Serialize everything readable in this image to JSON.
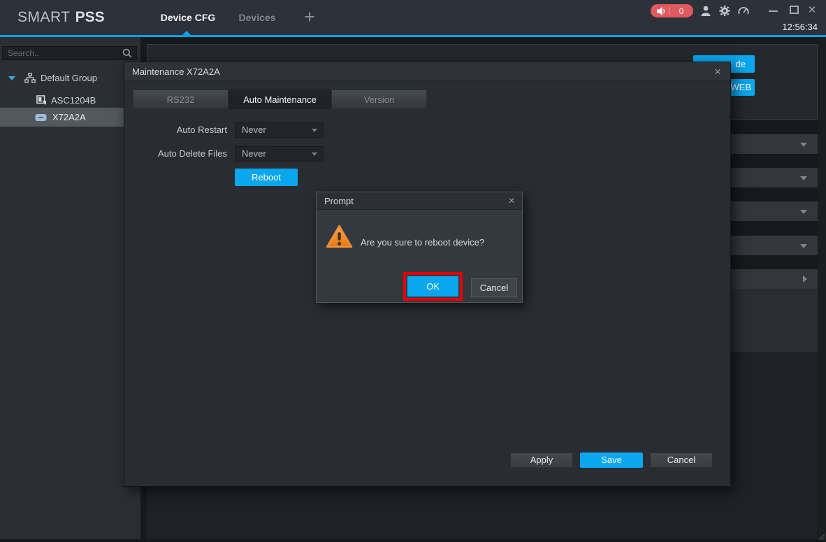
{
  "topbar": {
    "logo_part1": "SMART",
    "logo_part2": "PSS",
    "tabs": [
      {
        "label": "Device CFG",
        "active": true
      },
      {
        "label": "Devices",
        "active": false
      }
    ],
    "add_tab_label": "+",
    "alarm_badge_count": "0",
    "clock": "12:56:34"
  },
  "icons": {
    "close_glyph": "×"
  },
  "sidebar": {
    "search_placeholder": "Search..",
    "group_label": "Default Group",
    "devices": [
      {
        "name": "ASC1204B",
        "selected": false
      },
      {
        "name": "X72A2A",
        "selected": true
      }
    ]
  },
  "background_panel": {
    "upgrade_button_visible_text": "de",
    "web_button_visible_text": "WEB"
  },
  "maintenance_dialog": {
    "title": "Maintenance X72A2A",
    "tabs": [
      {
        "label": "RS232",
        "active": false
      },
      {
        "label": "Auto Maintenance",
        "active": true
      },
      {
        "label": "Version",
        "active": false
      }
    ],
    "fields": [
      {
        "label": "Auto Restart",
        "value": "Never"
      },
      {
        "label": "Auto Delete Files",
        "value": "Never"
      }
    ],
    "reboot_button": "Reboot",
    "apply_button": "Apply",
    "save_button": "Save",
    "cancel_button": "Cancel"
  },
  "prompt_dialog": {
    "title": "Prompt",
    "message": "Are you sure to reboot device?",
    "ok_button": "OK",
    "cancel_button": "Cancel"
  },
  "colors": {
    "accent_blue": "#0ba0e8",
    "button_blue": "#0aa6ee",
    "alarm_red": "#df595d",
    "annotation_red": "#e60000",
    "warning_orange": "#ef8318",
    "selected_row_gray": "#53585e"
  }
}
